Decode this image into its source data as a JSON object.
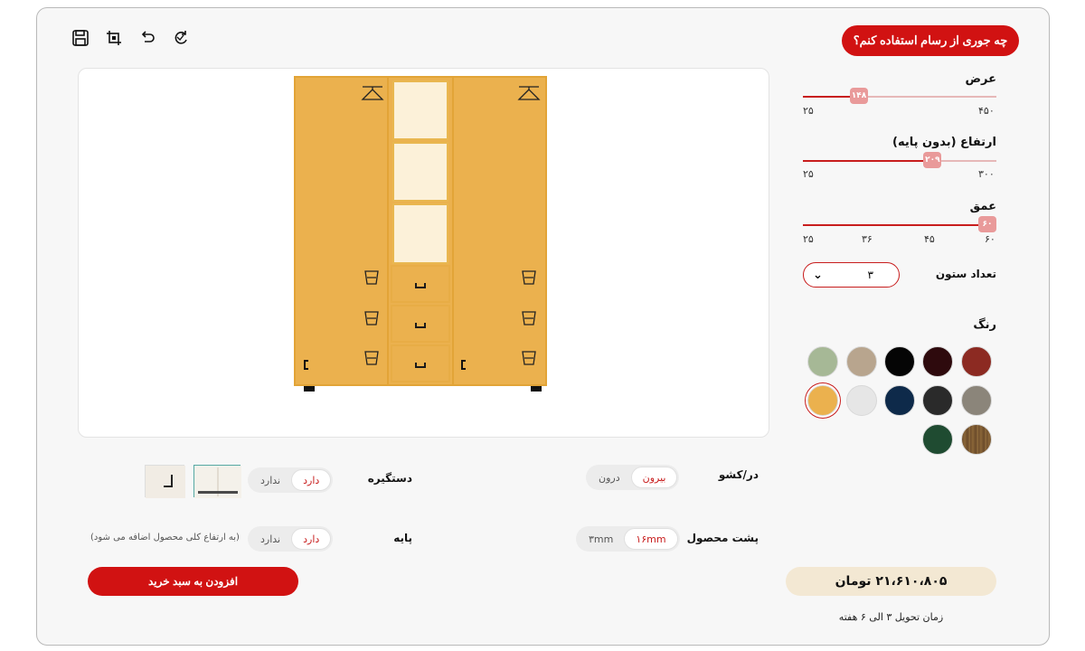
{
  "toolbar": {
    "save_icon": "save-icon",
    "crop_icon": "frame-icon",
    "undo_icon": "undo-icon",
    "reset_icon": "refresh-icon"
  },
  "help": {
    "label": "چه جوری از رسام استفاده کنم؟"
  },
  "dimensions": {
    "width": {
      "label": "عرض",
      "value": "۱۴۸",
      "min": "۲۵",
      "max": "۴۵۰",
      "fraction": 0.29
    },
    "height": {
      "label": "ارتفاع (بدون پایه)",
      "value": "۲۰۹",
      "min": "۲۵",
      "max": "۳۰۰",
      "fraction": 0.67
    },
    "depth": {
      "label": "عمق",
      "value": "۶۰",
      "ticks": [
        "۲۵",
        "۳۶",
        "۴۵",
        "۶۰"
      ],
      "fraction": 1.0
    }
  },
  "columns": {
    "label": "تعداد ستون",
    "value": "۳"
  },
  "color": {
    "label": "رنگ",
    "swatches": [
      "#8c2a22",
      "#2e0a0d",
      "#050505",
      "#b8a58e",
      "#a6b896",
      "#8b857a",
      "#2a2a2a",
      "#0e2a4a",
      "#e6e6e6",
      "#ebb14e",
      "#7b5a36",
      "#1f4b31"
    ],
    "selected": "#ebb14e"
  },
  "door_drawer": {
    "label": "در/کشو",
    "options": [
      "بیرون",
      "درون"
    ],
    "selected": "بیرون"
  },
  "handle": {
    "label": "دستگیره",
    "options": [
      "دارد",
      "ندارد"
    ],
    "selected": "دارد"
  },
  "back": {
    "label": "پشت محصول",
    "options": [
      "۱۶mm",
      "۳mm"
    ],
    "selected": "۱۶mm"
  },
  "base": {
    "label": "پایه",
    "options": [
      "دارد",
      "ندارد"
    ],
    "selected": "دارد",
    "note": "(به ارتفاع کلی محصول اضافه می شود)"
  },
  "cart": {
    "label": "افزودن به سبد خرید"
  },
  "price": {
    "value": "۲۱،۶۱۰،۸۰۵ تومان"
  },
  "delivery": {
    "text": "زمان تحویل ۳ الی ۶ هفته"
  }
}
